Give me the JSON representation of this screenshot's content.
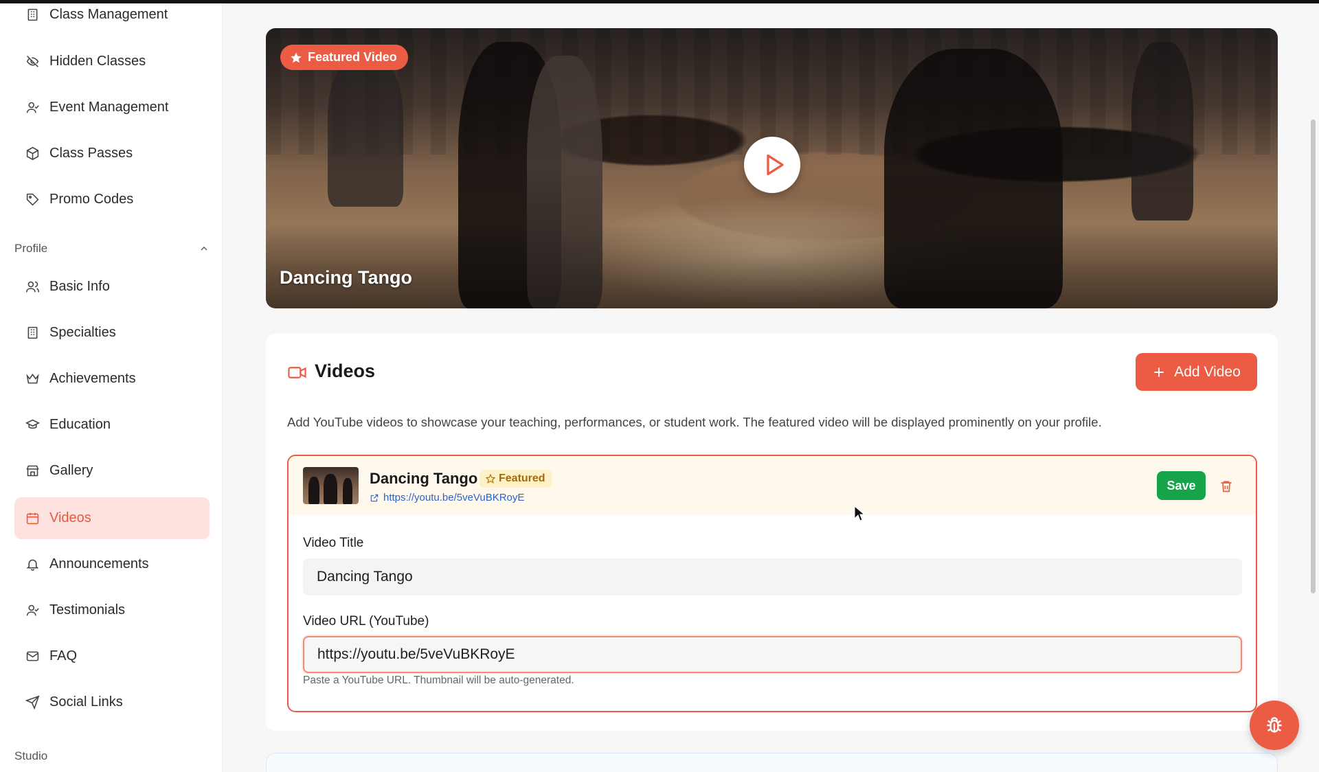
{
  "sidebar": {
    "items_top": [
      {
        "label": "Class Management",
        "icon": "building-icon"
      },
      {
        "label": "Hidden Classes",
        "icon": "eye-off-icon"
      },
      {
        "label": "Event Management",
        "icon": "user-check-icon"
      },
      {
        "label": "Class Passes",
        "icon": "package-icon"
      },
      {
        "label": "Promo Codes",
        "icon": "tag-icon"
      }
    ],
    "profile_section": "Profile",
    "items_profile": [
      {
        "label": "Basic Info",
        "icon": "users-icon"
      },
      {
        "label": "Specialties",
        "icon": "building-icon"
      },
      {
        "label": "Achievements",
        "icon": "crown-icon"
      },
      {
        "label": "Education",
        "icon": "graduation-cap-icon"
      },
      {
        "label": "Gallery",
        "icon": "store-icon"
      },
      {
        "label": "Videos",
        "icon": "calendar-icon",
        "active": true
      },
      {
        "label": "Announcements",
        "icon": "bell-icon"
      },
      {
        "label": "Testimonials",
        "icon": "user-check-icon"
      },
      {
        "label": "FAQ",
        "icon": "mail-icon"
      },
      {
        "label": "Social Links",
        "icon": "send-icon"
      }
    ],
    "studio_section": "Studio"
  },
  "hero": {
    "badge": "Featured Video",
    "title": "Dancing Tango"
  },
  "videos_card": {
    "title": "Videos",
    "add_button": "Add Video",
    "description": "Add YouTube videos to showcase your teaching, performances, or student work. The featured video will be displayed prominently on your profile.",
    "item": {
      "title": "Dancing Tango",
      "badge": "Featured",
      "link": "https://youtu.be/5veVuBKRoyE",
      "save_label": "Save",
      "title_label": "Video Title",
      "title_value": "Dancing Tango",
      "url_label": "Video URL (YouTube)",
      "url_value": "https://youtu.be/5veVuBKRoyE",
      "hint": "Paste a YouTube URL. Thumbnail will be auto-generated."
    }
  },
  "colors": {
    "accent": "#ec5b43",
    "active_bg": "#fde2df",
    "save_green": "#16a34a",
    "link_blue": "#2a63c9",
    "featured_bg": "#fdf1c7"
  }
}
